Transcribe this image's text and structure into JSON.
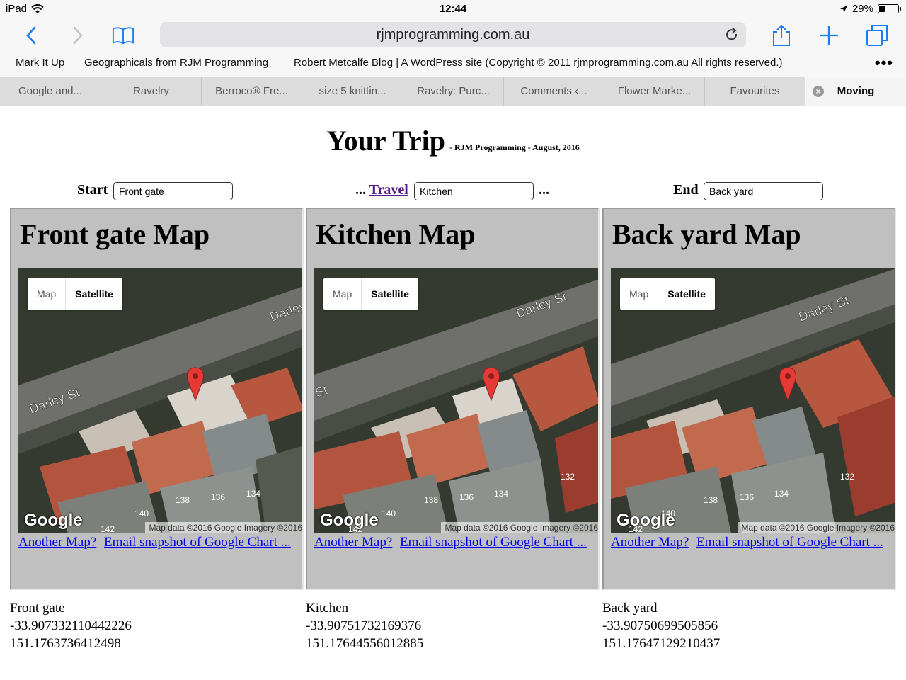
{
  "status_bar": {
    "device": "iPad",
    "time": "12:44",
    "battery_text": "29%",
    "battery_level": 0.29
  },
  "browser": {
    "url": "rjmprogramming.com.au",
    "bookmarks": [
      "Mark It Up",
      "Geographicals from RJM Programming",
      "Robert Metcalfe Blog | A WordPress site (Copyright © 2011 rjmprogramming.com.au All rights reserved.)"
    ],
    "more_label": "•••",
    "tabs": [
      "Google and...",
      "Ravelry",
      "Berroco® Fre...",
      "size 5 knittin...",
      "Ravelry: Purc...",
      "Comments ‹...",
      "Flower Marke...",
      "Favourites",
      "Moving"
    ],
    "active_tab": "Moving"
  },
  "page": {
    "title": "Your Trip",
    "subtitle": "- RJM Programming - August, 2016",
    "start_label": "Start",
    "travel_prefix": "...",
    "travel_link": "Travel",
    "travel_suffix": "...",
    "end_label": "End",
    "start_value": "Front gate",
    "travel_value": "Kitchen",
    "end_value": "Back yard",
    "panels": [
      {
        "heading": "Front gate Map",
        "map_type_map": "Map",
        "map_type_satellite": "Satellite",
        "street_labels": [
          "Darley St",
          "Darley"
        ],
        "house_numbers": [
          "134",
          "136",
          "138",
          "140",
          "142"
        ],
        "google_logo": "Google",
        "attribution": "Map data ©2016 Google Imagery ©2016",
        "link_another": "Another Map?",
        "link_email": "Email snapshot of Google Chart ...",
        "place": "Front gate",
        "lat": "-33.907332110442226",
        "lng": "151.1763736412498"
      },
      {
        "heading": "Kitchen Map",
        "map_type_map": "Map",
        "map_type_satellite": "Satellite",
        "street_labels": [
          "Darley St",
          "St"
        ],
        "house_numbers": [
          "132",
          "134",
          "136",
          "138",
          "140",
          "142"
        ],
        "google_logo": "Google",
        "attribution": "Map data ©2016 Google Imagery ©2016",
        "link_another": "Another Map?",
        "link_email": "Email snapshot of Google Chart ...",
        "place": "Kitchen",
        "lat": "-33.90751732169376",
        "lng": "151.17644556012885"
      },
      {
        "heading": "Back yard Map",
        "map_type_map": "Map",
        "map_type_satellite": "Satellite",
        "street_labels": [
          "Darley St"
        ],
        "house_numbers": [
          "132",
          "134",
          "136",
          "138",
          "140",
          "142"
        ],
        "google_logo": "Google",
        "attribution": "Map data ©2016 Google Imagery ©2016",
        "link_another": "Another Map?",
        "link_email": "Email snapshot of Google Chart ...",
        "place": "Back yard",
        "lat": "-33.90750699505856",
        "lng": "151.17647129210437"
      }
    ]
  },
  "colors": {
    "ios_blue": "#1a7cf5",
    "panel_gray": "#c0c0c0",
    "link_blue": "#0000ee",
    "visited_purple": "#551a8b",
    "pin_red": "#e53935"
  }
}
